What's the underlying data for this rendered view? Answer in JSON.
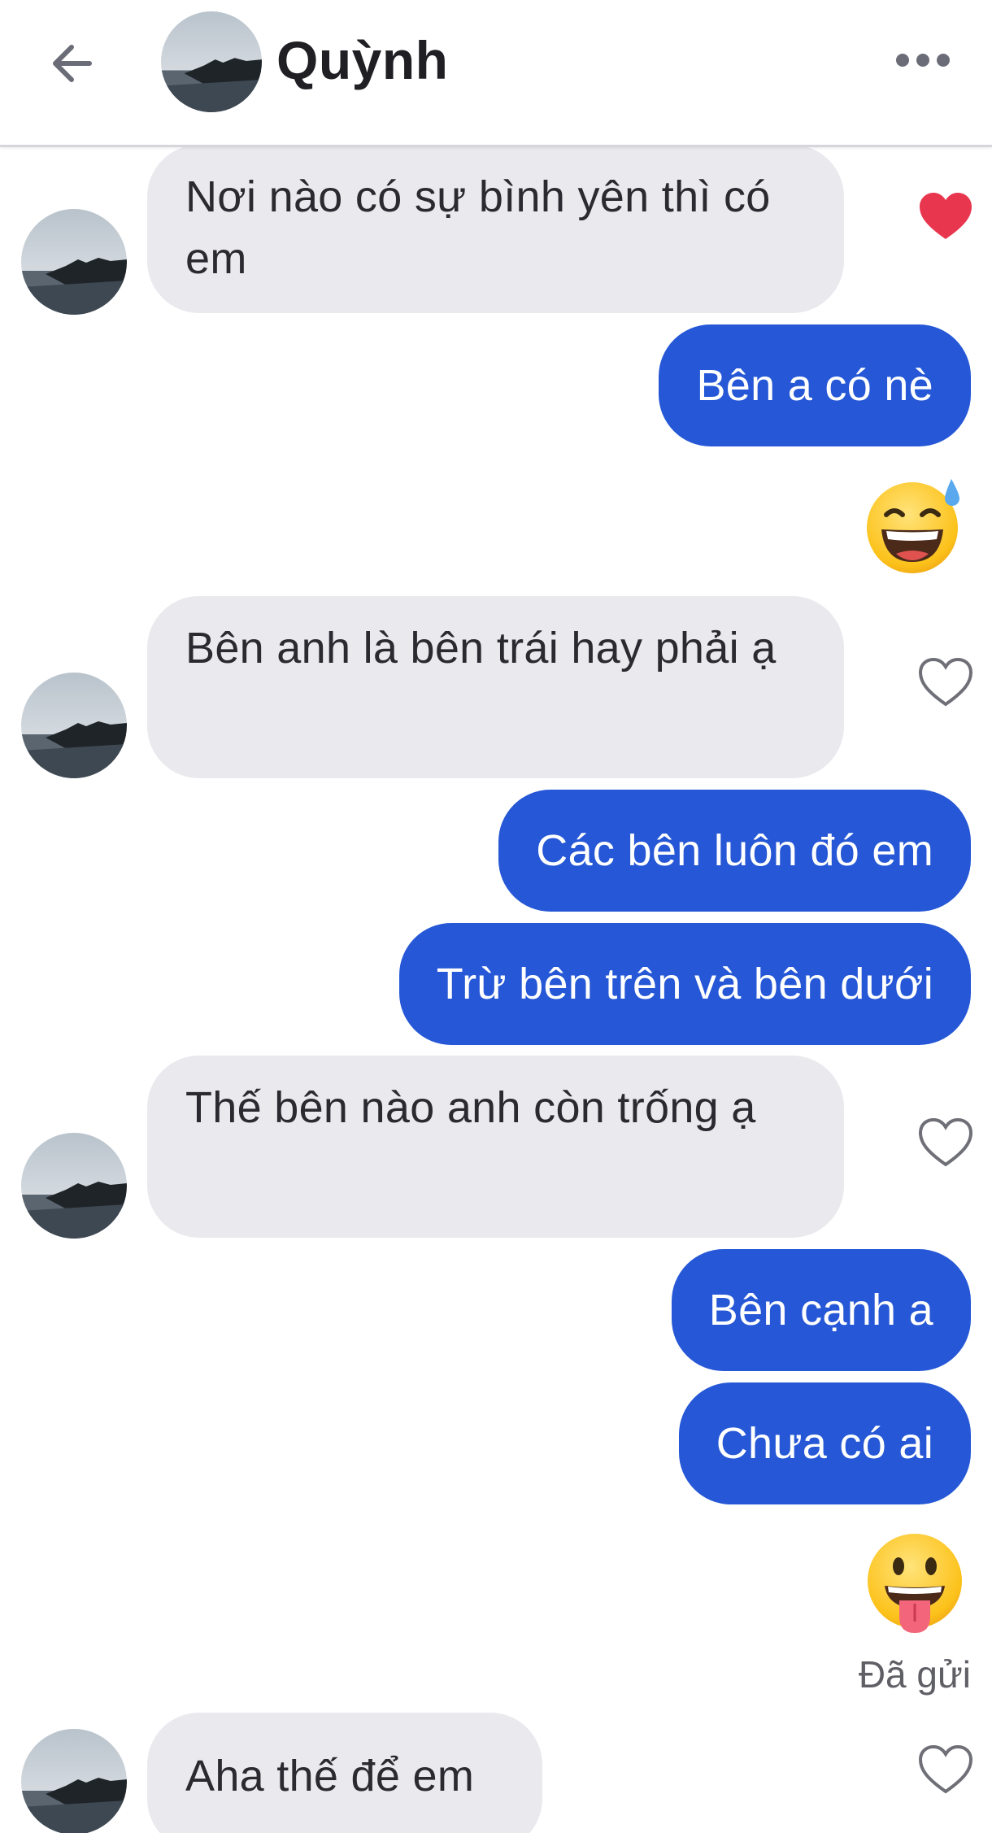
{
  "header": {
    "contact_name": "Quỳnh",
    "back_icon": "arrow-left-icon",
    "more_icon": "ellipsis-icon"
  },
  "messages": [
    {
      "direction": "incoming",
      "text": "Nơi nào có sự bình yên thì có em",
      "liked": true
    },
    {
      "direction": "outgoing",
      "text": "Bên a có nè"
    },
    {
      "direction": "outgoing",
      "emoji": "grinning-face-with-sweat-icon"
    },
    {
      "direction": "incoming",
      "text": "Bên anh là bên trái hay phải ạ",
      "liked": false
    },
    {
      "direction": "outgoing",
      "text": "Các bên luôn đó em"
    },
    {
      "direction": "outgoing",
      "text": "Trừ bên trên và bên dưới"
    },
    {
      "direction": "incoming",
      "text": "Thế bên nào anh còn trống ạ",
      "liked": false
    },
    {
      "direction": "outgoing",
      "text": "Bên cạnh a"
    },
    {
      "direction": "outgoing",
      "text": "Chưa có ai"
    },
    {
      "direction": "outgoing",
      "emoji": "face-with-tongue-icon"
    },
    {
      "direction": "incoming",
      "text": "Aha thế để em",
      "liked": false
    }
  ],
  "status": {
    "sent_label": "Đã gửi"
  },
  "colors": {
    "outgoing_bubble": "#2557d6",
    "incoming_bubble": "#e9e9ee",
    "heart_liked": "#e8364f",
    "heart_outline": "#6f6f78"
  }
}
